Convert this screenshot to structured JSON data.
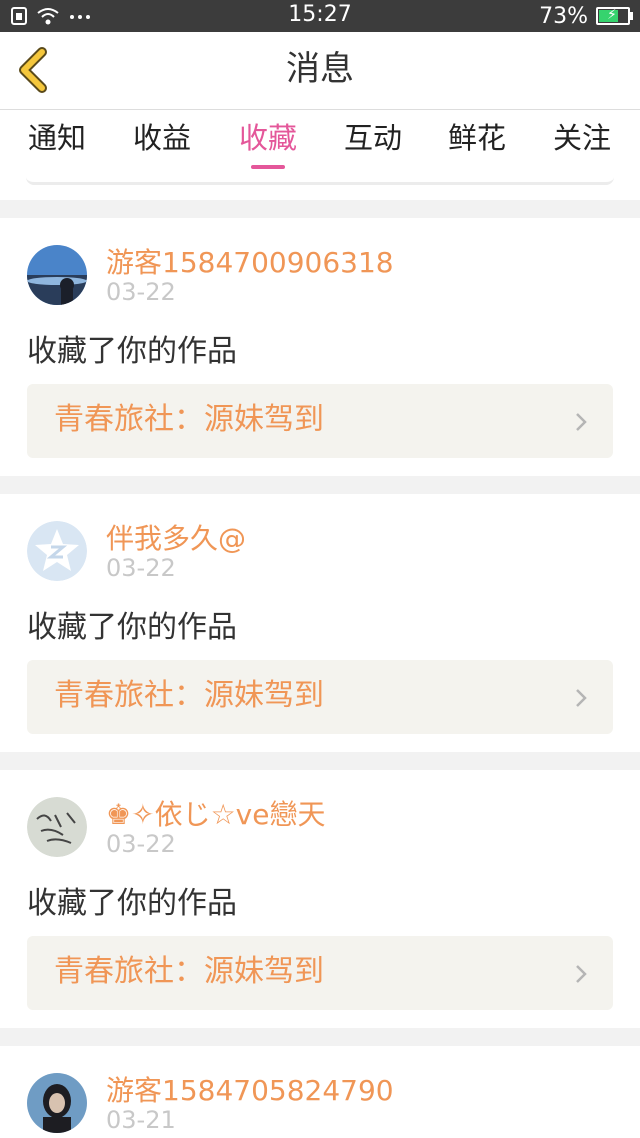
{
  "status_bar": {
    "time": "15:27",
    "battery_text": "73%",
    "battery_level": 0.73,
    "icons": [
      "sim-icon",
      "wifi-icon",
      "more-dots-icon",
      "battery-icon"
    ]
  },
  "header": {
    "title": "消息",
    "back_icon": "chevron-left-icon"
  },
  "tabs": [
    {
      "label": "通知",
      "active": false
    },
    {
      "label": "收益",
      "active": false
    },
    {
      "label": "收藏",
      "active": true
    },
    {
      "label": "互动",
      "active": false
    },
    {
      "label": "鲜花",
      "active": false
    },
    {
      "label": "关注",
      "active": false
    }
  ],
  "messages": [
    {
      "user": "游客1584700906318",
      "date": "03-22",
      "action": "收藏了你的作品",
      "work": "青春旅社：源妹驾到",
      "avatar": "photo-avatar-landscape"
    },
    {
      "user": "伴我多久@",
      "date": "03-22",
      "action": "收藏了你的作品",
      "work": "青春旅社：源妹驾到",
      "avatar": "default-star-avatar"
    },
    {
      "user": "♚✧依じ☆ve戀天",
      "date": "03-22",
      "action": "收藏了你的作品",
      "work": "青春旅社：源妹驾到",
      "avatar": "handwriting-avatar"
    },
    {
      "user": "游客1584705824790",
      "date": "03-21",
      "action": "",
      "work": "",
      "avatar": "photo-avatar-portrait"
    }
  ],
  "colors": {
    "accent_pink": "#e4579a",
    "username_orange": "#f09656",
    "status_bar_bg": "#3c3c3c",
    "back_icon_yellow": "#f5c73c"
  }
}
